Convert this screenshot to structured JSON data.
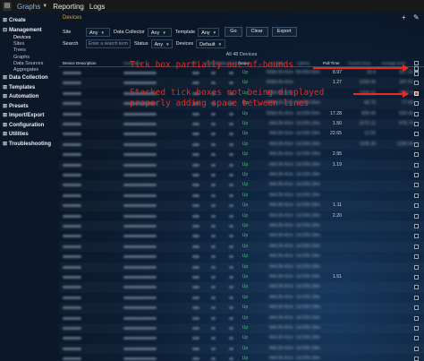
{
  "topbar": {
    "tabs": [
      "Graphs",
      "Reporting",
      "Logs"
    ]
  },
  "sidebar": {
    "items": [
      {
        "label": "Create",
        "subs": []
      },
      {
        "label": "Management",
        "subs": [
          "Devices",
          "Sites",
          "Trees",
          "Graphs",
          "Data Sources",
          "Aggregates"
        ]
      },
      {
        "label": "Data Collection",
        "subs": []
      },
      {
        "label": "Templates",
        "subs": []
      },
      {
        "label": "Automation",
        "subs": []
      },
      {
        "label": "Presets",
        "subs": []
      },
      {
        "label": "Import/Export",
        "subs": []
      },
      {
        "label": "Configuration",
        "subs": []
      },
      {
        "label": "Utilities",
        "subs": []
      },
      {
        "label": "Troubleshooting",
        "subs": []
      }
    ],
    "active_sub": "Devices"
  },
  "main": {
    "section_title": "Devices",
    "filters": {
      "site_label": "Site",
      "site_value": "Any",
      "collector_label": "Data Collector",
      "collector_value": "Any",
      "template_label": "Template",
      "template_value": "Any",
      "go_label": "Go",
      "clear_label": "Clear",
      "export_label": "Export",
      "search_label": "Search",
      "search_placeholder": "Enter a search term",
      "status_label": "Status",
      "status_value": "Any",
      "devices_label": "Devices",
      "devices_value": "Default"
    },
    "all_devices_text": "All 48 Devices",
    "columns": [
      "Device Description",
      "Hostname",
      "ID",
      "Graphs",
      "Data Sources",
      "Status",
      "In State",
      "Uptime",
      "Poll Time",
      "Current (ms)",
      "Average (ms)"
    ]
  },
  "table": {
    "rows": [
      {
        "status": "Up",
        "in_state": "558d:3h:41m",
        "uptime": "9d:05h:09m",
        "poll": "8.97",
        "current": "33.4",
        "average": "327.23",
        "checked": false
      },
      {
        "status": "Up",
        "in_state": "558d:3h:41m",
        "uptime": "",
        "poll": "1.27",
        "current": "1158.34",
        "average": "187.61",
        "checked": false
      },
      {
        "status": "Up",
        "in_state": "558d:3h:41m",
        "uptime": "",
        "poll": "",
        "current": "1316.11",
        "average": "1907.3",
        "checked": true
      },
      {
        "status": "Up",
        "in_state": "558d:3h:41m",
        "uptime": "1d:20h:00m",
        "poll": "",
        "current": "68.75",
        "average": "77.49",
        "checked": false
      },
      {
        "status": "Up",
        "in_state": "558d:3h:41m",
        "uptime": "1d:20h:00m",
        "poll": "17.28",
        "current": "839.45",
        "average": "630.46",
        "checked": false
      },
      {
        "status": "Up",
        "in_state": "44d:3h:41m",
        "uptime": "1d:20h:16m",
        "poll": "1.50",
        "current": "1070.12",
        "average": "978.74",
        "checked": false
      },
      {
        "status": "Up",
        "in_state": "44d:3h:41m",
        "uptime": "1d:20h:18m",
        "poll": "22.65",
        "current": "12.55",
        "average": "",
        "checked": false
      },
      {
        "status": "Up",
        "in_state": "44d:3h:41m",
        "uptime": "1d:20h:18m",
        "poll": "",
        "current": "1158.34",
        "average": "1158.34",
        "checked": false
      },
      {
        "status": "Up",
        "in_state": "44d:3h:41m",
        "uptime": "1d:20h:18m",
        "poll": "2.95",
        "current": "",
        "average": "",
        "checked": false
      },
      {
        "status": "Up",
        "in_state": "44d:3h:41m",
        "uptime": "1d:20h:18m",
        "poll": "1.19",
        "current": "",
        "average": "",
        "checked": false
      },
      {
        "status": "Up",
        "in_state": "44d:3h:41m",
        "uptime": "1d:20h:18m",
        "poll": "",
        "current": "",
        "average": "",
        "checked": false
      },
      {
        "status": "Up",
        "in_state": "44d:3h:41m",
        "uptime": "1d:20h:18m",
        "poll": "",
        "current": "",
        "average": "",
        "checked": false
      },
      {
        "status": "Up",
        "in_state": "44d:3h:41m",
        "uptime": "1d:20h:18m",
        "poll": "",
        "current": "",
        "average": "",
        "checked": false
      },
      {
        "status": "Up",
        "in_state": "44d:3h:41m",
        "uptime": "1d:20h:18m",
        "poll": "1.11",
        "current": "",
        "average": "",
        "checked": false
      },
      {
        "status": "Up",
        "in_state": "44d:3h:41m",
        "uptime": "1d:20h:18m",
        "poll": "2.20",
        "current": "",
        "average": "",
        "checked": false
      },
      {
        "status": "Up",
        "in_state": "44d:3h:41m",
        "uptime": "1d:20h:18m",
        "poll": "",
        "current": "",
        "average": "",
        "checked": false
      },
      {
        "status": "Up",
        "in_state": "44d:3h:41m",
        "uptime": "1d:20h:18m",
        "poll": "",
        "current": "",
        "average": "",
        "checked": false
      },
      {
        "status": "Up",
        "in_state": "44d:3h:41m",
        "uptime": "1d:20h:18m",
        "poll": "",
        "current": "",
        "average": "",
        "checked": false
      },
      {
        "status": "Up",
        "in_state": "44d:3h:41m",
        "uptime": "1d:20h:18m",
        "poll": "",
        "current": "",
        "average": "",
        "checked": false
      },
      {
        "status": "Up",
        "in_state": "44d:3h:41m",
        "uptime": "1d:20h:18m",
        "poll": "",
        "current": "",
        "average": "",
        "checked": false
      },
      {
        "status": "Up",
        "in_state": "44d:3h:41m",
        "uptime": "1d:20h:18m",
        "poll": "1.51",
        "current": "",
        "average": "",
        "checked": false
      },
      {
        "status": "Up",
        "in_state": "44d:3h:41m",
        "uptime": "1d:20h:18m",
        "poll": "",
        "current": "",
        "average": "",
        "checked": false
      },
      {
        "status": "Up",
        "in_state": "44d:3h:41m",
        "uptime": "1d:20h:18m",
        "poll": "",
        "current": "",
        "average": "",
        "checked": false
      },
      {
        "status": "Up",
        "in_state": "44d:3h:41m",
        "uptime": "1d:20h:18m",
        "poll": "",
        "current": "",
        "average": "",
        "checked": false
      },
      {
        "status": "Up",
        "in_state": "44d:3h:41m",
        "uptime": "1d:20h:18m",
        "poll": "",
        "current": "",
        "average": "",
        "checked": false
      },
      {
        "status": "Up",
        "in_state": "44d:3h:41m",
        "uptime": "1d:20h:18m",
        "poll": "",
        "current": "",
        "average": "",
        "checked": false
      },
      {
        "status": "Up",
        "in_state": "44d:3h:41m",
        "uptime": "1d:20h:18m",
        "poll": "",
        "current": "",
        "average": "",
        "checked": false
      },
      {
        "status": "Up",
        "in_state": "44d:3h:41m",
        "uptime": "1d:20h:18m",
        "poll": "",
        "current": "",
        "average": "",
        "checked": false
      },
      {
        "status": "Up",
        "in_state": "44d:3h:41m",
        "uptime": "1d:20h:18m",
        "poll": "",
        "current": "",
        "average": "",
        "checked": false
      }
    ]
  },
  "annotations": {
    "line1": "Tick box partially out-of-bounds",
    "line2": "Stacked tick boxes not being displayed",
    "line3": "properly adding space between lines"
  },
  "colors": {
    "annotation": "#e82a22",
    "status_up": "#3cc06a",
    "section_title": "#d9a13a",
    "checked_box": "#c9502e"
  }
}
